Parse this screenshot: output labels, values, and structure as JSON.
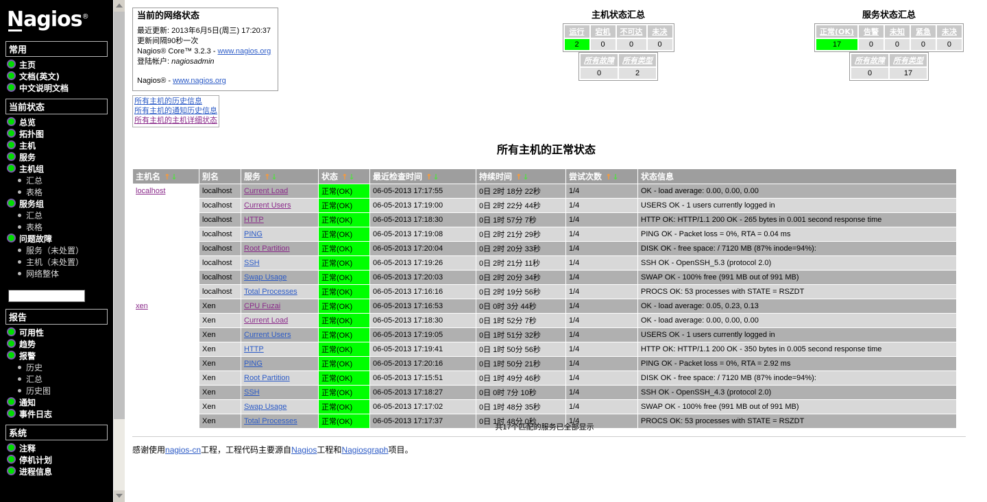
{
  "sidebar": {
    "logo": {
      "text": "Nagios",
      "reg": "®"
    },
    "sections": [
      {
        "heading": "常用",
        "items": [
          {
            "label": "主页"
          },
          {
            "label": "文档(英文)"
          },
          {
            "label": "中文说明文档"
          }
        ]
      },
      {
        "heading": "当前状态",
        "items": [
          {
            "label": "总览"
          },
          {
            "label": "拓扑图"
          },
          {
            "label": "主机"
          },
          {
            "label": "服务"
          },
          {
            "label": "主机组",
            "children": [
              "汇总",
              "表格"
            ]
          },
          {
            "label": "服务组",
            "children": [
              "汇总",
              "表格"
            ]
          },
          {
            "label": "问题故障",
            "children": [
              "服务（未处置）",
              "主机（未处置）",
              "网络整体"
            ]
          }
        ]
      },
      {
        "heading": "报告",
        "items": [
          {
            "label": "可用性"
          },
          {
            "label": "趋势"
          },
          {
            "label": "报警",
            "children": [
              "历史",
              "汇总",
              "历史图"
            ]
          },
          {
            "label": "通知"
          },
          {
            "label": "事件日志"
          }
        ]
      },
      {
        "heading": "系统",
        "items": [
          {
            "label": "注释"
          },
          {
            "label": "停机计划"
          },
          {
            "label": "进程信息"
          }
        ]
      }
    ],
    "search_value": "",
    "search_placeholder": ""
  },
  "status_box": {
    "title": "当前的网络状态",
    "last_update_label": "最近更新:",
    "last_update_value": "2013年6月5日(周三) 17:20:37",
    "interval": "更新间隔90秒一次",
    "core_prefix": "Nagios® Core™ 3.2.3 - ",
    "core_link": "www.nagios.org",
    "login_label": "登陆帐户:",
    "login_user": "nagiosadmin",
    "bottom_prefix": "Nagios® - ",
    "bottom_link": "www.nagios.org"
  },
  "link_box": {
    "links": [
      {
        "label": "所有主机的历史信息",
        "visited": false
      },
      {
        "label": "所有主机的通知历史信息",
        "visited": false
      },
      {
        "label": "所有主机的主机详细状态",
        "visited": true
      }
    ]
  },
  "host_summary": {
    "title": "主机状态汇总",
    "headers": [
      "运行",
      "宕机",
      "不可达",
      "未决"
    ],
    "values": [
      "2",
      "0",
      "0",
      "0"
    ],
    "ok_index": 0,
    "sub_headers": [
      "所有故障",
      "所有类型"
    ],
    "sub_values": [
      "0",
      "2"
    ]
  },
  "service_summary": {
    "title": "服务状态汇总",
    "headers": [
      "正常(OK)",
      "告警",
      "未知",
      "紧急",
      "未决"
    ],
    "values": [
      "17",
      "0",
      "0",
      "0",
      "0"
    ],
    "ok_index": 0,
    "sub_headers": [
      "所有故障",
      "所有类型"
    ],
    "sub_values": [
      "0",
      "17"
    ]
  },
  "page_title": "所有主机的正常状态",
  "table": {
    "columns": [
      {
        "label": "主机名",
        "sortable": true
      },
      {
        "label": "别名",
        "sortable": false
      },
      {
        "label": "服务",
        "sortable": true
      },
      {
        "label": "状态",
        "sortable": true
      },
      {
        "label": "最近检查时间",
        "sortable": true
      },
      {
        "label": "持续时间",
        "sortable": true
      },
      {
        "label": "尝试次数",
        "sortable": true
      },
      {
        "label": "状态信息",
        "sortable": false
      }
    ],
    "sort_up": "↑",
    "sort_down": "↓",
    "rows": [
      {
        "host": "localhost",
        "host_visited": true,
        "alias": "localhost",
        "service": "Current Load",
        "service_visited": true,
        "state": "正常(OK)",
        "last_check": "06-05-2013 17:17:55",
        "duration": "0日  2时  18分  22秒",
        "attempt": "1/4",
        "info": "OK - load average: 0.00, 0.00, 0.00"
      },
      {
        "host": "",
        "alias": "localhost",
        "service": "Current Users",
        "service_visited": true,
        "state": "正常(OK)",
        "last_check": "06-05-2013 17:19:00",
        "duration": "0日  2时  22分  44秒",
        "attempt": "1/4",
        "info": "USERS OK - 1 users currently logged in"
      },
      {
        "host": "",
        "alias": "localhost",
        "service": "HTTP",
        "service_visited": true,
        "state": "正常(OK)",
        "last_check": "06-05-2013 17:18:30",
        "duration": "0日  1时  57分  7秒",
        "attempt": "1/4",
        "info": "HTTP OK: HTTP/1.1 200 OK - 265 bytes in 0.001 second response time"
      },
      {
        "host": "",
        "alias": "localhost",
        "service": "PING",
        "service_visited": false,
        "state": "正常(OK)",
        "last_check": "06-05-2013 17:19:08",
        "duration": "0日  2时  21分  29秒",
        "attempt": "1/4",
        "info": "PING OK - Packet loss = 0%, RTA = 0.04 ms"
      },
      {
        "host": "",
        "alias": "localhost",
        "service": "Root Partition",
        "service_visited": true,
        "state": "正常(OK)",
        "last_check": "06-05-2013 17:20:04",
        "duration": "0日  2时  20分  33秒",
        "attempt": "1/4",
        "info": "DISK OK - free space: / 7120 MB (87% inode=94%):"
      },
      {
        "host": "",
        "alias": "localhost",
        "service": "SSH",
        "service_visited": false,
        "state": "正常(OK)",
        "last_check": "06-05-2013 17:19:26",
        "duration": "0日  2时  21分  11秒",
        "attempt": "1/4",
        "info": "SSH OK - OpenSSH_5.3 (protocol 2.0)"
      },
      {
        "host": "",
        "alias": "localhost",
        "service": "Swap Usage",
        "service_visited": false,
        "state": "正常(OK)",
        "last_check": "06-05-2013 17:20:03",
        "duration": "0日  2时  20分  34秒",
        "attempt": "1/4",
        "info": "SWAP OK - 100% free (991 MB out of 991 MB)"
      },
      {
        "host": "",
        "alias": "localhost",
        "service": "Total Processes",
        "service_visited": false,
        "state": "正常(OK)",
        "last_check": "06-05-2013 17:16:16",
        "duration": "0日  2时  19分  56秒",
        "attempt": "1/4",
        "info": "PROCS OK: 53 processes with STATE = RSZDT"
      },
      {
        "host": "xen",
        "host_visited": true,
        "alias": "Xen",
        "service": "CPU Fuzai",
        "service_visited": true,
        "state": "正常(OK)",
        "last_check": "06-05-2013 17:16:53",
        "duration": "0日  0时  3分  44秒",
        "attempt": "1/4",
        "info": "OK - load average: 0.05, 0.23, 0.13",
        "group_start": true
      },
      {
        "host": "",
        "alias": "Xen",
        "service": "Current Load",
        "service_visited": true,
        "state": "正常(OK)",
        "last_check": "06-05-2013 17:18:30",
        "duration": "0日  1时  52分  7秒",
        "attempt": "1/4",
        "info": "OK - load average: 0.00, 0.00, 0.00"
      },
      {
        "host": "",
        "alias": "Xen",
        "service": "Current Users",
        "service_visited": false,
        "state": "正常(OK)",
        "last_check": "06-05-2013 17:19:05",
        "duration": "0日  1时  51分  32秒",
        "attempt": "1/4",
        "info": "USERS OK - 1 users currently logged in"
      },
      {
        "host": "",
        "alias": "Xen",
        "service": "HTTP",
        "service_visited": false,
        "state": "正常(OK)",
        "last_check": "06-05-2013 17:19:41",
        "duration": "0日  1时  50分  56秒",
        "attempt": "1/4",
        "info": "HTTP OK: HTTP/1.1 200 OK - 350 bytes in 0.005 second response time"
      },
      {
        "host": "",
        "alias": "Xen",
        "service": "PING",
        "service_visited": false,
        "state": "正常(OK)",
        "last_check": "06-05-2013 17:20:16",
        "duration": "0日  1时  50分  21秒",
        "attempt": "1/4",
        "info": "PING OK - Packet loss = 0%, RTA = 2.92 ms"
      },
      {
        "host": "",
        "alias": "Xen",
        "service": "Root Partition",
        "service_visited": false,
        "state": "正常(OK)",
        "last_check": "06-05-2013 17:15:51",
        "duration": "0日  1时  49分  46秒",
        "attempt": "1/4",
        "info": "DISK OK - free space: / 7120 MB (87% inode=94%):"
      },
      {
        "host": "",
        "alias": "Xen",
        "service": "SSH",
        "service_visited": false,
        "state": "正常(OK)",
        "last_check": "06-05-2013 17:18:27",
        "duration": "0日  0时  7分  10秒",
        "attempt": "1/4",
        "info": "SSH OK - OpenSSH_4.3 (protocol 2.0)"
      },
      {
        "host": "",
        "alias": "Xen",
        "service": "Swap Usage",
        "service_visited": false,
        "state": "正常(OK)",
        "last_check": "06-05-2013 17:17:02",
        "duration": "0日  1时  48分  35秒",
        "attempt": "1/4",
        "info": "SWAP OK - 100% free (991 MB out of 991 MB)"
      },
      {
        "host": "",
        "alias": "Xen",
        "service": "Total Processes",
        "service_visited": false,
        "state": "正常(OK)",
        "last_check": "06-05-2013 17:17:37",
        "duration": "0日  1时  48分  0秒",
        "attempt": "1/4",
        "info": "PROCS OK: 53 processes with STATE = RSZDT"
      }
    ]
  },
  "total_line": "共17个匹配的服务已全部显示",
  "footer": {
    "part1": "感谢使用",
    "link1": "nagios-cn",
    "part2": "工程，工程代码主要源自",
    "link2": "Nagios",
    "part3": "工程和",
    "link3": "Nagiosgraph",
    "part4": "项目。"
  },
  "colors": {
    "ok_green": "#00ff00",
    "header_gray": "#9e9e9e",
    "row_odd": "#b0b0b0",
    "row_even": "#d8d8d8",
    "link_blue": "#2b5ac6",
    "link_visited": "#8a2a8a",
    "sidebar_bg": "#000000"
  }
}
